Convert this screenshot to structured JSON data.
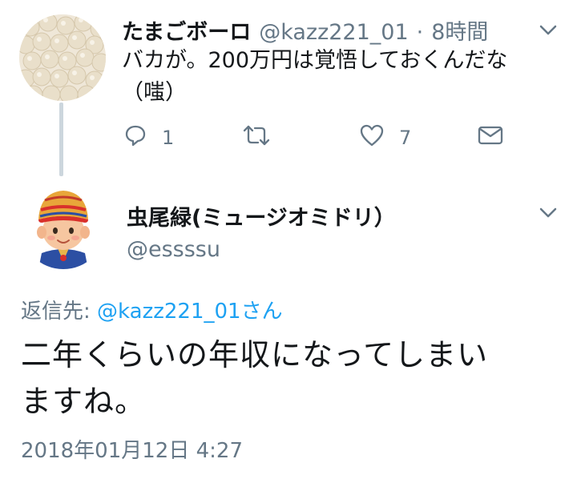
{
  "tweet1": {
    "display_name": "たまごボーロ",
    "handle": "@kazz221_01",
    "separator": "·",
    "time": "8時間",
    "text_line1": "バカが。200万円は覚悟しておくんだな",
    "text_line2": "（嗤）",
    "actions": {
      "reply_icon": "reply-icon",
      "reply_count": "1",
      "retweet_icon": "retweet-icon",
      "like_icon": "heart-icon",
      "like_count": "7",
      "dm_icon": "mail-icon"
    }
  },
  "tweet2": {
    "display_name": "虫尾緑(ミュージオミドリ）",
    "handle": "@essssu",
    "reply_prefix": "返信先: ",
    "reply_mention": "@kazz221_01さん",
    "text_line1": "二年くらいの年収になってしまい",
    "text_line2": "ますね。",
    "timestamp": "2018年01月12日 4:27"
  },
  "colors": {
    "secondary_text": "#657786",
    "link": "#1da1f2",
    "primary_text": "#14171a",
    "thread_line": "#ccd6dd"
  }
}
